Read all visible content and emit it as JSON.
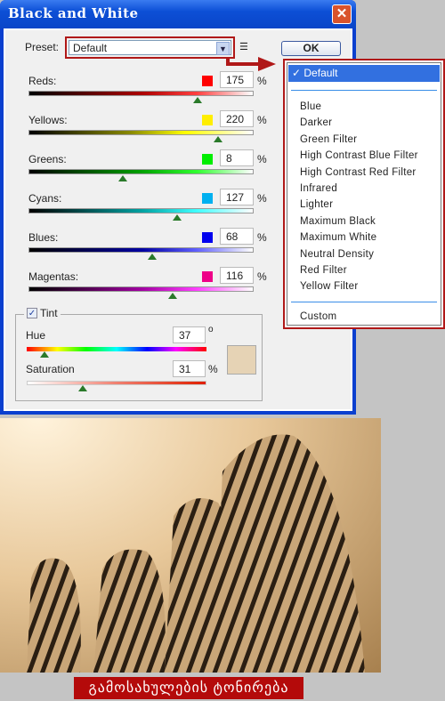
{
  "window": {
    "title": "Black and White",
    "close": "✕"
  },
  "preset": {
    "label": "Preset:",
    "value": "Default"
  },
  "ok_label": "OK",
  "channels": [
    {
      "label": "Reds:",
      "value": "175",
      "unit": "%",
      "color": "#ff0000",
      "pos": 0.75,
      "grad": "linear-gradient(90deg,#000,#a00 50%,#ff4040 75%,#fff)"
    },
    {
      "label": "Yellows:",
      "value": "220",
      "unit": "%",
      "color": "#ffee00",
      "pos": 0.84,
      "grad": "linear-gradient(90deg,#000,#888800 45%,#ffff00 70%,#fff)"
    },
    {
      "label": "Greens:",
      "value": "8",
      "unit": "%",
      "color": "#00ee00",
      "pos": 0.42,
      "grad": "linear-gradient(90deg,#000,#00a000 50%,#30ff30 75%,#fff)"
    },
    {
      "label": "Cyans:",
      "value": "127",
      "unit": "%",
      "color": "#00b0f0",
      "pos": 0.66,
      "grad": "linear-gradient(90deg,#000,#00a0a0 50%,#40ffff 75%,#fff)"
    },
    {
      "label": "Blues:",
      "value": "68",
      "unit": "%",
      "color": "#0000ee",
      "pos": 0.55,
      "grad": "linear-gradient(90deg,#000,#0000a0 50%,#6060ff 75%,#fff)"
    },
    {
      "label": "Magentas:",
      "value": "116",
      "unit": "%",
      "color": "#ee0088",
      "pos": 0.64,
      "grad": "linear-gradient(90deg,#000,#a000a0 50%,#ff40ff 75%,#fff)"
    }
  ],
  "tint": {
    "label": "Tint",
    "checked": true,
    "hue_label": "Hue",
    "hue": "37",
    "hue_unit": "o",
    "sat_label": "Saturation",
    "sat": "31",
    "sat_unit": "%",
    "color": "#e6d3b5"
  },
  "dropdown": {
    "selected": "Default",
    "items": [
      "Blue",
      "Darker",
      "Green Filter",
      "High Contrast Blue Filter",
      "High Contrast Red Filter",
      "Infrared",
      "Lighter",
      "Maximum Black",
      "Maximum White",
      "Neutral Density",
      "Red Filter",
      "Yellow Filter"
    ],
    "custom": "Custom"
  },
  "caption": "გამოსახულების ტონირება"
}
